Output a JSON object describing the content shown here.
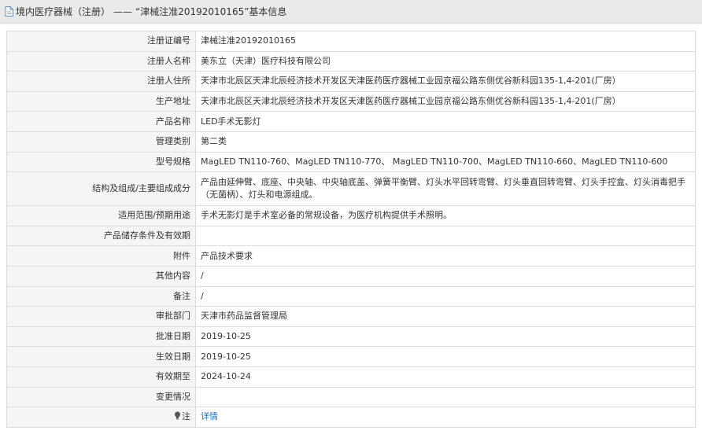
{
  "header": {
    "category": "境内医疗器械（注册）",
    "separator": "——",
    "record_title": "“津械注准20192010165”基本信息"
  },
  "rows": [
    {
      "label": "注册证编号",
      "value": "津械注准20192010165"
    },
    {
      "label": "注册人名称",
      "value": "美东立（天津）医疗科技有限公司"
    },
    {
      "label": "注册人住所",
      "value": "天津市北辰区天津北辰经济技术开发区天津医药医疗器械工业园京福公路东侧优谷新科园135-1,4-201(厂房）"
    },
    {
      "label": "生产地址",
      "value": "天津市北辰区天津北辰经济技术开发区天津医药医疗器械工业园京福公路东侧优谷新科园135-1,4-201(厂房）"
    },
    {
      "label": "产品名称",
      "value": "LED手术无影灯"
    },
    {
      "label": "管理类别",
      "value": "第二类"
    },
    {
      "label": "型号规格",
      "value": "MagLED TN110-760、MagLED TN110-770、 MagLED TN110-700、MagLED TN110-660、MagLED TN110-600"
    },
    {
      "label": "结构及组成/主要组成成分",
      "value": "产品由延伸臂、底座、中央轴、中央轴底盖、弹簧平衡臂、灯头水平回转弯臂、灯头垂直回转弯臂、灯头手控盒、灯头消毒把手（无菌柄）、灯头和电源组成。"
    },
    {
      "label": "适用范围/预期用途",
      "value": "手术无影灯是手术室必备的常规设备，为医疗机构提供手术照明。"
    },
    {
      "label": "产品储存条件及有效期",
      "value": ""
    },
    {
      "label": "附件",
      "value": "产品技术要求"
    },
    {
      "label": "其他内容",
      "value": "/"
    },
    {
      "label": "备注",
      "value": "/"
    },
    {
      "label": "审批部门",
      "value": "天津市药品监督管理局"
    },
    {
      "label": "批准日期",
      "value": "2019-10-25"
    },
    {
      "label": "生效日期",
      "value": "2019-10-25"
    },
    {
      "label": "有效期至",
      "value": "2024-10-24"
    },
    {
      "label": "变更情况",
      "value": ""
    }
  ],
  "note_row": {
    "label": "注",
    "icon": "lightbulb-icon",
    "link_text": "详情"
  },
  "colors": {
    "header_bg": "#eaeaea",
    "label_bg": "#f5f5f5",
    "border": "#dcdcdc",
    "link": "#2a6db0"
  }
}
